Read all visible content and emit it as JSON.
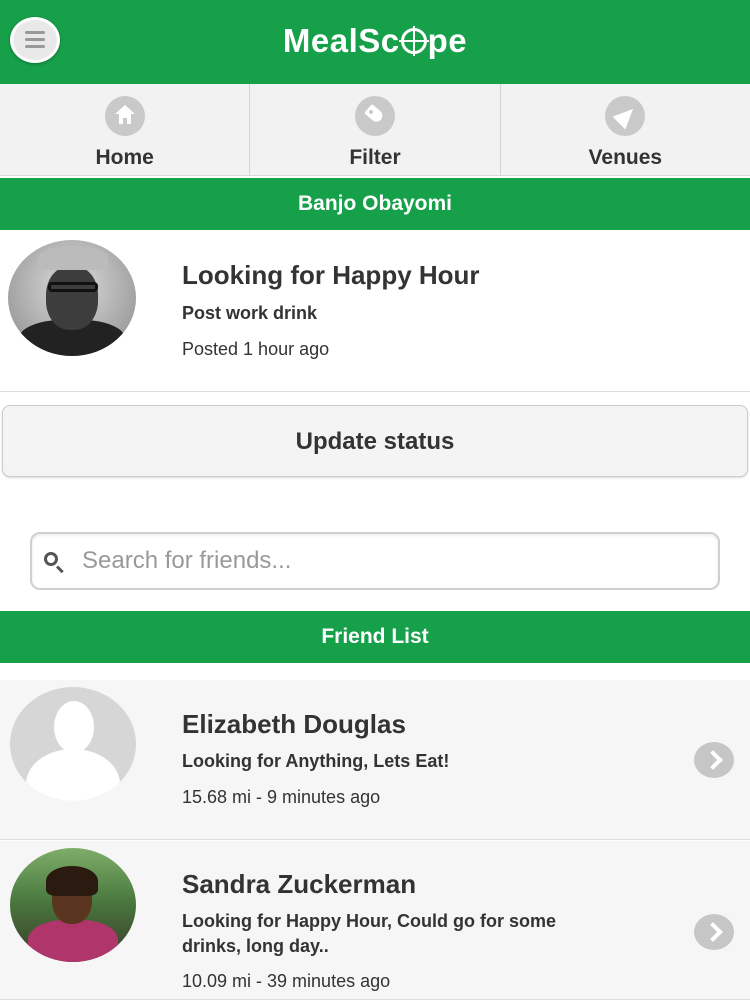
{
  "header": {
    "logo_text_before": "MealSc",
    "logo_text_after": "pe",
    "menu_icon": "menu-icon"
  },
  "nav": {
    "tabs": [
      {
        "label": "Home",
        "icon": "home-icon"
      },
      {
        "label": "Filter",
        "icon": "tag-icon"
      },
      {
        "label": "Venues",
        "icon": "location-arrow-icon"
      }
    ]
  },
  "profile": {
    "name": "Banjo Obayomi",
    "status_title": "Looking for Happy Hour",
    "status_note": "Post work drink",
    "posted": "Posted 1 hour ago"
  },
  "update_button": "Update status",
  "search": {
    "placeholder": "Search for friends...",
    "value": ""
  },
  "friend_list": {
    "title": "Friend List",
    "friends": [
      {
        "name": "Elizabeth Douglas",
        "status": "Looking for Anything, Lets Eat!",
        "meta": "15.68 mi - 9 minutes ago"
      },
      {
        "name": "Sandra Zuckerman",
        "status": "Looking for Happy Hour, Could go for some drinks, long day..",
        "meta": "10.09 mi - 39 minutes ago"
      }
    ]
  },
  "colors": {
    "brand_green": "#16a04a",
    "tab_bg": "#f2f2f2",
    "icon_gray": "#c9c9c9"
  }
}
